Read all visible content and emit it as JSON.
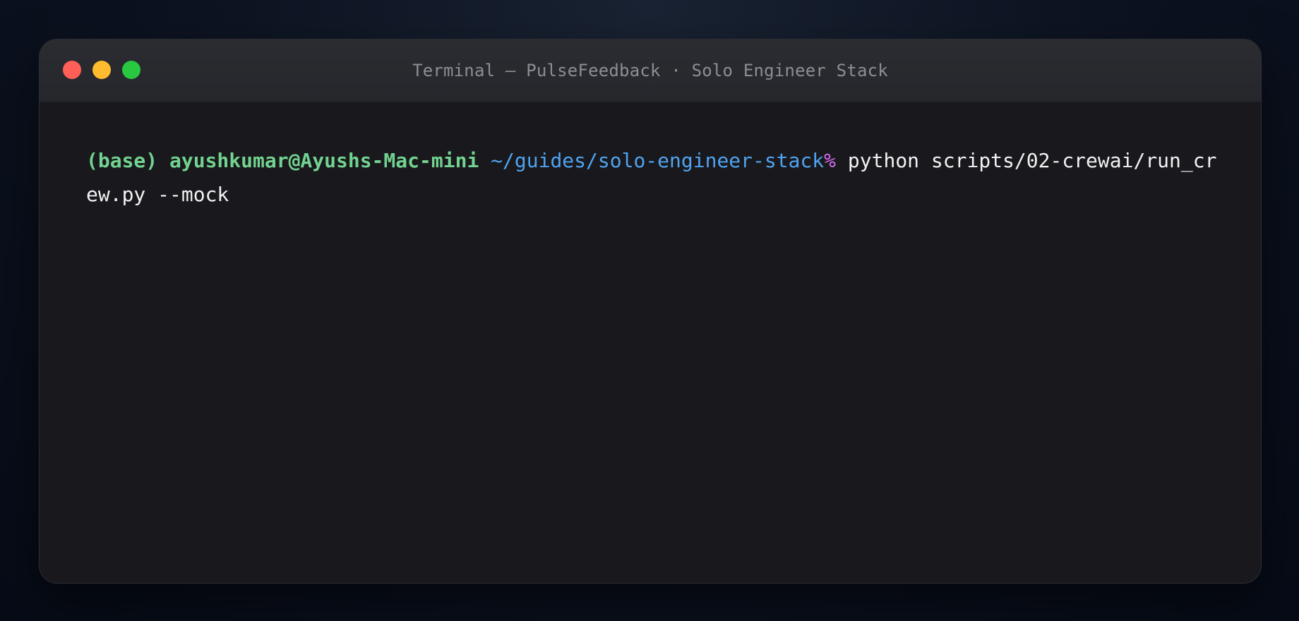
{
  "window": {
    "title": "Terminal — PulseFeedback · Solo Engineer Stack"
  },
  "traffic_lights": [
    {
      "name": "close",
      "color": "#ff5f57"
    },
    {
      "name": "minimize",
      "color": "#febc2e"
    },
    {
      "name": "zoom",
      "color": "#28c840"
    }
  ],
  "terminal": {
    "prompt_user": "(base) ayushkumar@Ayushs-Mac-mini",
    "prompt_path": "~/guides/solo-engineer-stack",
    "prompt_symbol": "%",
    "command": "python scripts/02-crewai/run_crew.py --mock"
  },
  "colors": {
    "prompt_user": "#72d28f",
    "prompt_path": "#4fa3f0",
    "prompt_symbol": "#d86af0",
    "command_text": "#f2f2f4",
    "terminal_background": "#19191d"
  }
}
